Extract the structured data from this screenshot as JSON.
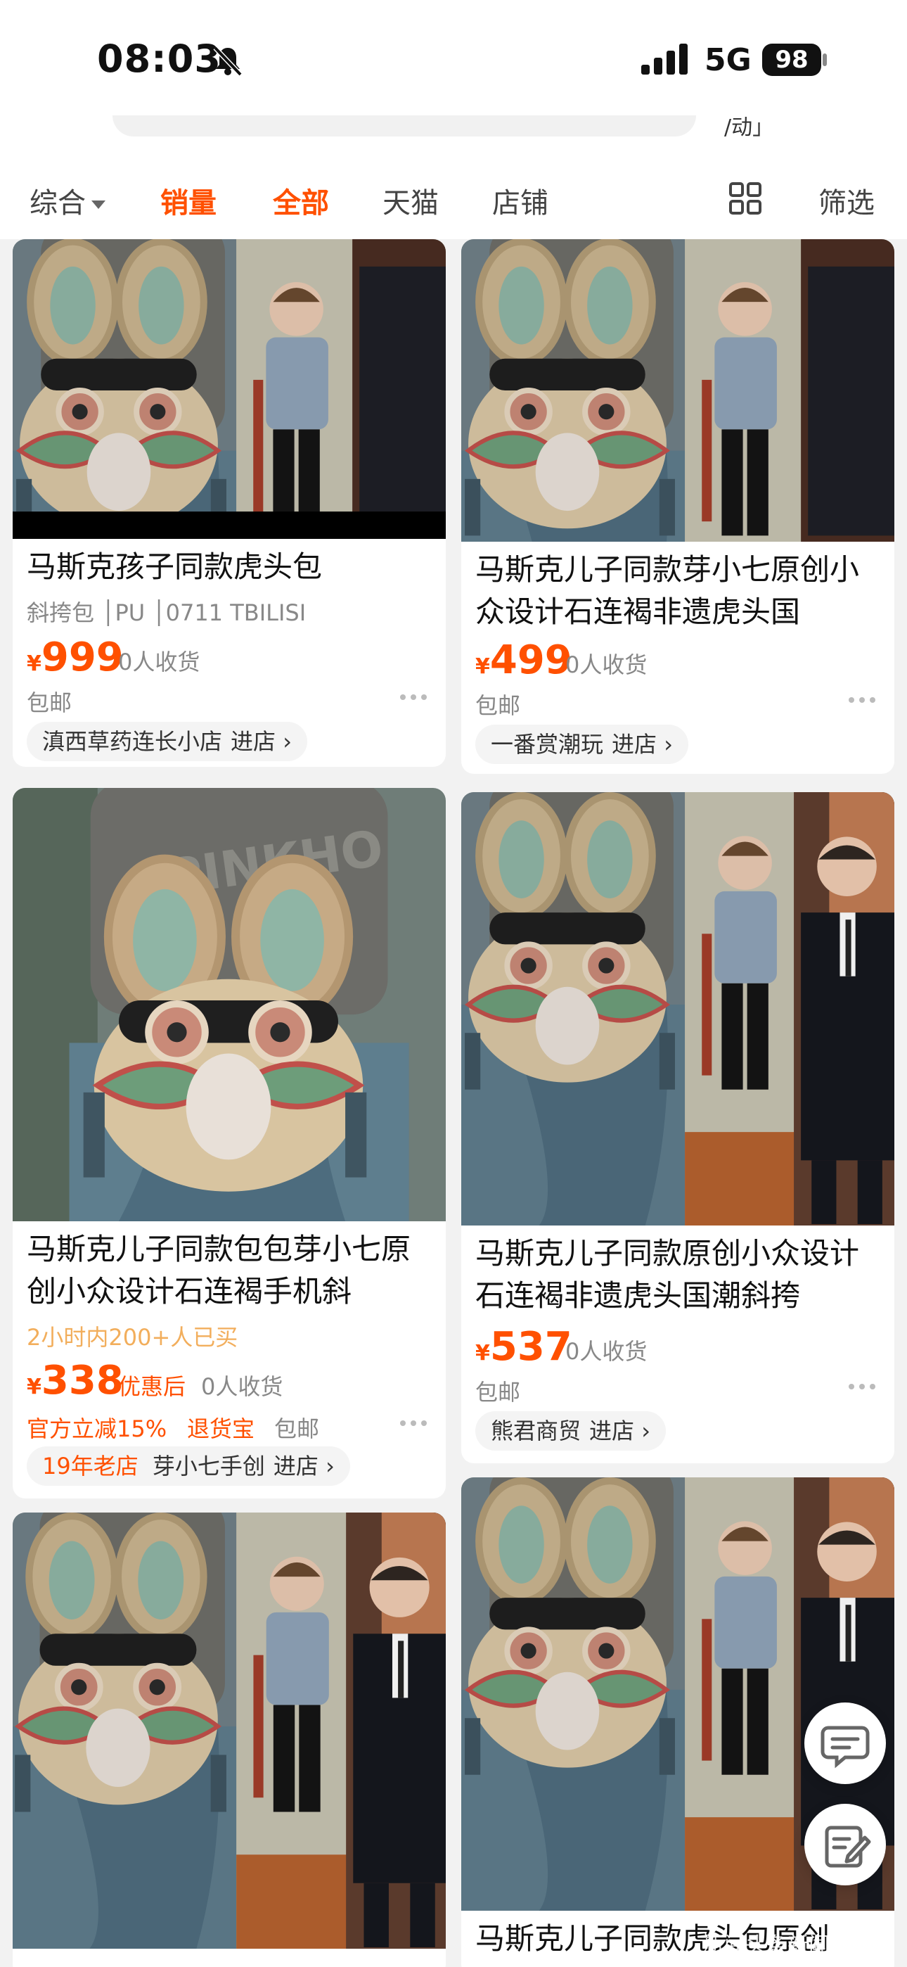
{
  "status": {
    "time": "08:03",
    "network": "5G",
    "battery": "98"
  },
  "search": {
    "trailing_text": "/动」"
  },
  "filters": {
    "items": [
      "综合",
      "销量",
      "全部",
      "天猫",
      "店铺"
    ],
    "filter_label": "筛选"
  },
  "products": [
    {
      "title": "马斯克孩子同款虎头包",
      "attrs": "斜挎包 │PU │0711 TBILISI",
      "yen": "¥",
      "price": "999",
      "sold": "0人收货",
      "shipping": "包邮",
      "shop": "滇西草药连长小店",
      "enter": "进店 ›"
    },
    {
      "title": "马斯克儿子同款芽小七原创小众设计石连褐非遗虎头国",
      "yen": "¥",
      "price": "499",
      "sold": "0人收货",
      "shipping": "包邮",
      "shop": "一番赏潮玩",
      "enter": "进店 ›"
    },
    {
      "title": "马斯克儿子同款包包芽小七原创小众设计石连褐手机斜",
      "bought": "2小时内200+人已买",
      "yen": "¥",
      "price": "338",
      "discount_label": "优惠后",
      "sold": "0人收货",
      "promo1": "官方立减15%",
      "promo2": "退货宝",
      "shipping": "包邮",
      "shop_badge": "19年老店",
      "shop": "芽小七手创",
      "enter": "进店 ›"
    },
    {
      "title": "马斯克儿子同款原创小众设计石连褐非遗虎头国潮斜挎",
      "yen": "¥",
      "price": "537",
      "sold": "0人收货",
      "shipping": "包邮",
      "shop": "熊君商贸",
      "enter": "进店 ›"
    },
    {
      "title": "马斯克儿子同款虎头包原创"
    }
  ],
  "watermark": "新闻头条新闻频道",
  "colors": {
    "accent": "#ff5000"
  }
}
